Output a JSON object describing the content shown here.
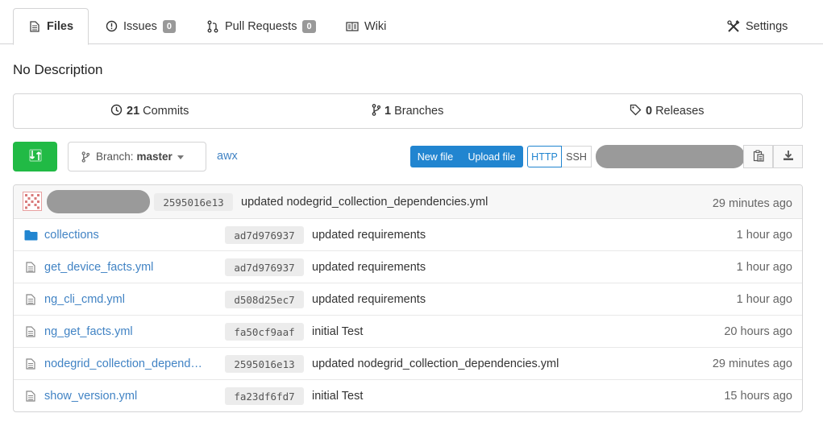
{
  "tabs": [
    {
      "label": "Files",
      "icon": "file-icon"
    },
    {
      "label": "Issues",
      "icon": "issue-icon",
      "count": "0"
    },
    {
      "label": "Pull Requests",
      "icon": "pull-request-icon",
      "count": "0"
    },
    {
      "label": "Wiki",
      "icon": "wiki-icon"
    }
  ],
  "settings": {
    "label": "Settings",
    "icon": "tools-icon"
  },
  "description": "No Description",
  "stats": {
    "commits": {
      "count": "21",
      "label": "Commits"
    },
    "branches": {
      "count": "1",
      "label": "Branches"
    },
    "releases": {
      "count": "0",
      "label": "Releases"
    }
  },
  "toolbar": {
    "branch_prefix": "Branch:",
    "branch": "master",
    "repo_link": "awx",
    "new_file": "New file",
    "upload_file": "Upload file",
    "http": "HTTP",
    "ssh": "SSH"
  },
  "latest_commit": {
    "sha": "2595016e13",
    "message": "updated nodegrid_collection_dependencies.yml",
    "age": "29 minutes ago"
  },
  "files": [
    {
      "name": "collections",
      "type": "folder",
      "sha": "ad7d976937",
      "message": "updated requirements",
      "age": "1 hour ago"
    },
    {
      "name": "get_device_facts.yml",
      "type": "file",
      "sha": "ad7d976937",
      "message": "updated requirements",
      "age": "1 hour ago"
    },
    {
      "name": "ng_cli_cmd.yml",
      "type": "file",
      "sha": "d508d25ec7",
      "message": "updated requirements",
      "age": "1 hour ago"
    },
    {
      "name": "ng_get_facts.yml",
      "type": "file",
      "sha": "fa50cf9aaf",
      "message": "initial Test",
      "age": "20 hours ago"
    },
    {
      "name": "nodegrid_collection_depend…",
      "type": "file",
      "sha": "2595016e13",
      "message": "updated nodegrid_collection_dependencies.yml",
      "age": "29 minutes ago"
    },
    {
      "name": "show_version.yml",
      "type": "file",
      "sha": "fa23df6fd7",
      "message": "initial Test",
      "age": "15 hours ago"
    }
  ],
  "colors": {
    "accent": "#2185d0",
    "green": "#21ba45",
    "link": "#4183c4"
  }
}
